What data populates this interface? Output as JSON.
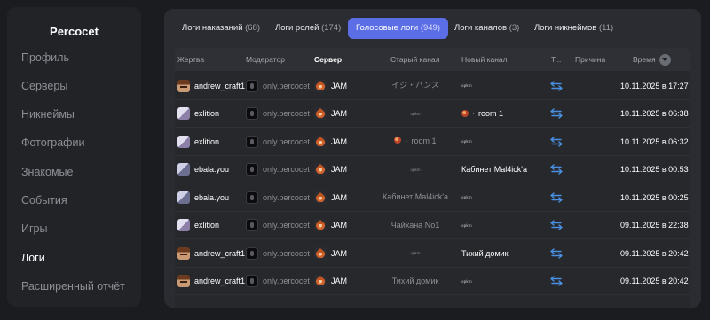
{
  "sidebar": {
    "brand": "Percocet",
    "items": [
      {
        "label": "Профиль"
      },
      {
        "label": "Серверы"
      },
      {
        "label": "Никнеймы"
      },
      {
        "label": "Фотографии"
      },
      {
        "label": "Знакомые"
      },
      {
        "label": "События"
      },
      {
        "label": "Игры"
      },
      {
        "label": "Логи"
      },
      {
        "label": "Расширенный отчёт"
      }
    ],
    "active_index": 7
  },
  "tabs": [
    {
      "label": "Логи наказаний",
      "count": "(68)"
    },
    {
      "label": "Логи ролей",
      "count": "(174)"
    },
    {
      "label": "Голосовые логи",
      "count": "(949)"
    },
    {
      "label": "Логи каналов",
      "count": "(3)"
    },
    {
      "label": "Логи никнеймов",
      "count": "(11)"
    }
  ],
  "active_tab": 2,
  "table": {
    "headers": {
      "victim": "Жертва",
      "moderator": "Модератор",
      "server": "Сервер",
      "old_channel": "Старый канал",
      "new_channel": "Новый канал",
      "type": "Т...",
      "reason": "Причина",
      "time": "Время"
    },
    "rows": [
      {
        "victim": "andrew_craft1",
        "moderator": "only.percocet",
        "server": "JAM",
        "old_channel": "イジ・ハンス",
        "new_channel": "opkm",
        "time": "10.11.2025 в 17:27"
      },
      {
        "victim": "exlition",
        "moderator": "only.percocet",
        "server": "JAM",
        "old_channel": "opkm",
        "new_channel": "room 1",
        "time": "10.11.2025 в 06:38"
      },
      {
        "victim": "exlition",
        "moderator": "only.percocet",
        "server": "JAM",
        "old_channel": "room 1",
        "new_channel": "opkm",
        "time": "10.11.2025 в 06:32"
      },
      {
        "victim": "ebala.you",
        "moderator": "only.percocet",
        "server": "JAM",
        "old_channel": "opkm",
        "new_channel": "Кабинет Mal4ick'a",
        "time": "10.11.2025 в 00:53"
      },
      {
        "victim": "ebala.you",
        "moderator": "only.percocet",
        "server": "JAM",
        "old_channel": "Кабинет Mal4ick'a",
        "new_channel": "opkm",
        "time": "10.11.2025 в 00:25"
      },
      {
        "victim": "exlition",
        "moderator": "only.percocet",
        "server": "JAM",
        "old_channel": "Чайхана No1",
        "new_channel": "opkm",
        "time": "09.11.2025 в 22:38"
      },
      {
        "victim": "andrew_craft1",
        "moderator": "only.percocet",
        "server": "JAM",
        "old_channel": "opkm",
        "new_channel": "Тихий домик",
        "time": "09.11.2025 в 20:42"
      },
      {
        "victim": "andrew_craft1",
        "moderator": "only.percocet",
        "server": "JAM",
        "old_channel": "Тихий домик",
        "new_channel": "opkm",
        "time": "09.11.2025 в 20:42"
      }
    ]
  },
  "colors": {
    "accent": "#5b6ee6",
    "swap_icon": "#4a90e2"
  }
}
